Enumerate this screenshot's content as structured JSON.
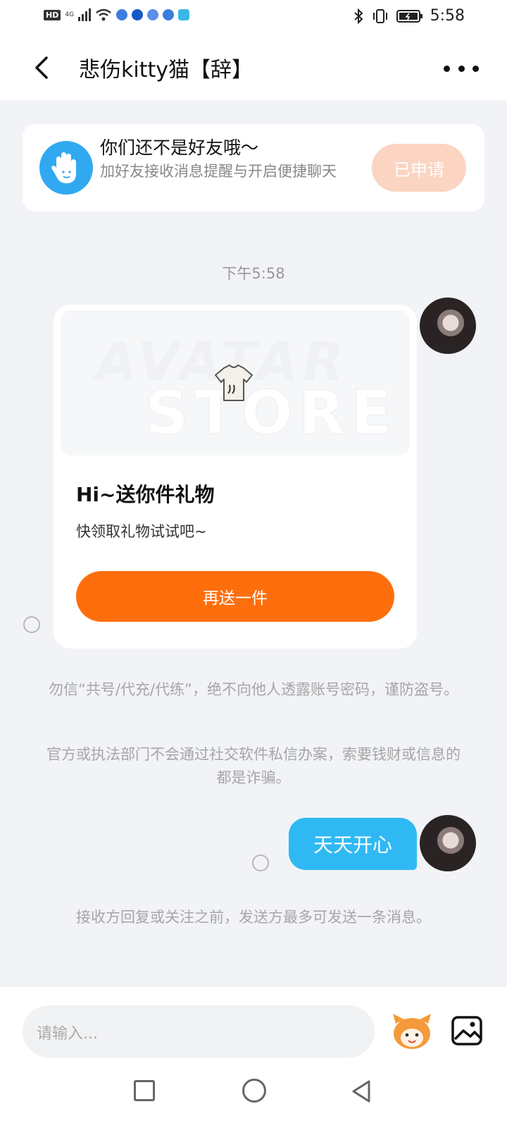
{
  "status_bar": {
    "hd": "HD",
    "network": "4G",
    "time": "5:58"
  },
  "header": {
    "title": "悲伤kitty猫【辞】"
  },
  "friend_notice": {
    "title": "你们还不是好友哦～",
    "subtitle": "加好友接收消息提醒与开启便捷聊天",
    "button": "已申请"
  },
  "chat": {
    "timestamp": "下午5:58",
    "gift_card": {
      "watermark_top": "AVATAR",
      "watermark_bottom": "STORE",
      "title": "Hi~送你件礼物",
      "subtitle": "快领取礼物试试吧~",
      "button": "再送一件"
    },
    "notice_1": "勿信“共号/代充/代练”，绝不向他人透露账号密码，谨防盗号。",
    "notice_2": "官方或执法部门不会通过社交软件私信办案，索要钱财或信息的都是诈骗。",
    "message": "天天开心",
    "notice_3": "接收方回复或关注之前，发送方最多可发送一条消息。"
  },
  "composer": {
    "placeholder": "请输入..."
  },
  "colors": {
    "accent_orange": "#ff6e0c",
    "bubble_blue": "#2fb9f3",
    "applied_button": "#fbd4c2"
  }
}
